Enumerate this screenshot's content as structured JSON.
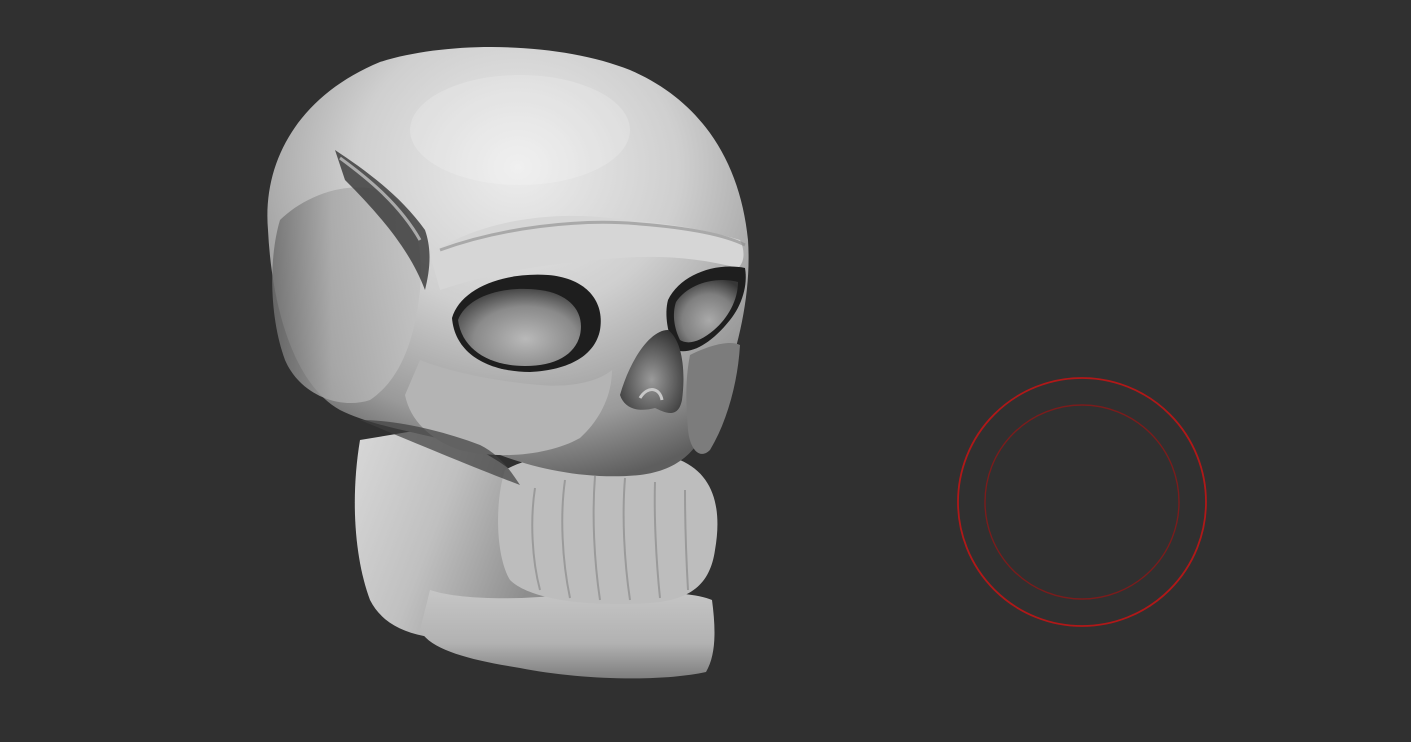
{
  "viewport": {
    "background_color": "#303030",
    "model": {
      "name": "skull-model",
      "base_color": "#c8c8c8",
      "highlight_color": "#f2f2f2",
      "shadow_color": "#4a4a4a",
      "cavity_color": "#1e1e1e"
    },
    "brush_cursor": {
      "outer_color": "#b01818",
      "inner_color": "#7a1c1c"
    }
  }
}
